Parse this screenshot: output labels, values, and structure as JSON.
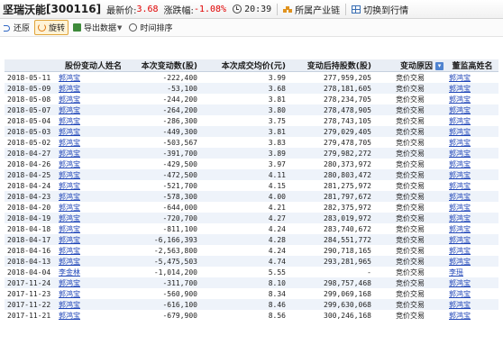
{
  "titlebar": {
    "name": "坚瑞沃能",
    "code": "[300116]",
    "price_label": "最新价:",
    "price": "3.68",
    "change_label": "涨跌幅:",
    "change": "-1.08%",
    "time": "20:39",
    "industry_link": "所属产业链",
    "quote_link": "切换到行情"
  },
  "toolbar": {
    "undo": "还原",
    "rotate": "旋转",
    "export": "导出数据",
    "sort": "时间排序"
  },
  "table": {
    "headers": [
      "",
      "股份变动人姓名",
      "本次变动数(股)",
      "本次成交均价(元)",
      "变动后持股数(股)",
      "变动原因",
      "董监高姓名"
    ],
    "rows": [
      [
        "2018-05-11",
        "郭鸿宝",
        "-222,400",
        "3.99",
        "277,959,205",
        "竞价交易",
        "郭鸿宝"
      ],
      [
        "2018-05-09",
        "郭鸿宝",
        "-53,100",
        "3.68",
        "278,181,605",
        "竞价交易",
        "郭鸿宝"
      ],
      [
        "2018-05-08",
        "郭鸿宝",
        "-244,200",
        "3.81",
        "278,234,705",
        "竞价交易",
        "郭鸿宝"
      ],
      [
        "2018-05-07",
        "郭鸿宝",
        "-264,200",
        "3.80",
        "278,478,905",
        "竞价交易",
        "郭鸿宝"
      ],
      [
        "2018-05-04",
        "郭鸿宝",
        "-286,300",
        "3.75",
        "278,743,105",
        "竞价交易",
        "郭鸿宝"
      ],
      [
        "2018-05-03",
        "郭鸿宝",
        "-449,300",
        "3.81",
        "279,029,405",
        "竞价交易",
        "郭鸿宝"
      ],
      [
        "2018-05-02",
        "郭鸿宝",
        "-503,567",
        "3.83",
        "279,478,705",
        "竞价交易",
        "郭鸿宝"
      ],
      [
        "2018-04-27",
        "郭鸿宝",
        "-391,700",
        "3.89",
        "279,982,272",
        "竞价交易",
        "郭鸿宝"
      ],
      [
        "2018-04-26",
        "郭鸿宝",
        "-429,500",
        "3.97",
        "280,373,972",
        "竞价交易",
        "郭鸿宝"
      ],
      [
        "2018-04-25",
        "郭鸿宝",
        "-472,500",
        "4.11",
        "280,803,472",
        "竞价交易",
        "郭鸿宝"
      ],
      [
        "2018-04-24",
        "郭鸿宝",
        "-521,700",
        "4.15",
        "281,275,972",
        "竞价交易",
        "郭鸿宝"
      ],
      [
        "2018-04-23",
        "郭鸿宝",
        "-578,300",
        "4.00",
        "281,797,672",
        "竞价交易",
        "郭鸿宝"
      ],
      [
        "2018-04-20",
        "郭鸿宝",
        "-644,000",
        "4.21",
        "282,375,972",
        "竞价交易",
        "郭鸿宝"
      ],
      [
        "2018-04-19",
        "郭鸿宝",
        "-720,700",
        "4.27",
        "283,019,972",
        "竞价交易",
        "郭鸿宝"
      ],
      [
        "2018-04-18",
        "郭鸿宝",
        "-811,100",
        "4.24",
        "283,740,672",
        "竞价交易",
        "郭鸿宝"
      ],
      [
        "2018-04-17",
        "郭鸿宝",
        "-6,166,393",
        "4.28",
        "284,551,772",
        "竞价交易",
        "郭鸿宝"
      ],
      [
        "2018-04-16",
        "郭鸿宝",
        "-2,563,800",
        "4.24",
        "290,718,165",
        "竞价交易",
        "郭鸿宝"
      ],
      [
        "2018-04-13",
        "郭鸿宝",
        "-5,475,503",
        "4.74",
        "293,281,965",
        "竞价交易",
        "郭鸿宝"
      ],
      [
        "2018-04-04",
        "李金林",
        "-1,014,200",
        "5.55",
        "-",
        "竞价交易",
        "李瑶"
      ],
      [
        "2017-11-24",
        "郭鸿宝",
        "-311,700",
        "8.10",
        "298,757,468",
        "竞价交易",
        "郭鸿宝"
      ],
      [
        "2017-11-23",
        "郭鸿宝",
        "-560,900",
        "8.34",
        "299,069,168",
        "竞价交易",
        "郭鸿宝"
      ],
      [
        "2017-11-22",
        "郭鸿宝",
        "-616,100",
        "8.46",
        "299,630,068",
        "竞价交易",
        "郭鸿宝"
      ],
      [
        "2017-11-21",
        "郭鸿宝",
        "-679,900",
        "8.56",
        "300,246,168",
        "竞价交易",
        "郭鸿宝"
      ]
    ]
  }
}
